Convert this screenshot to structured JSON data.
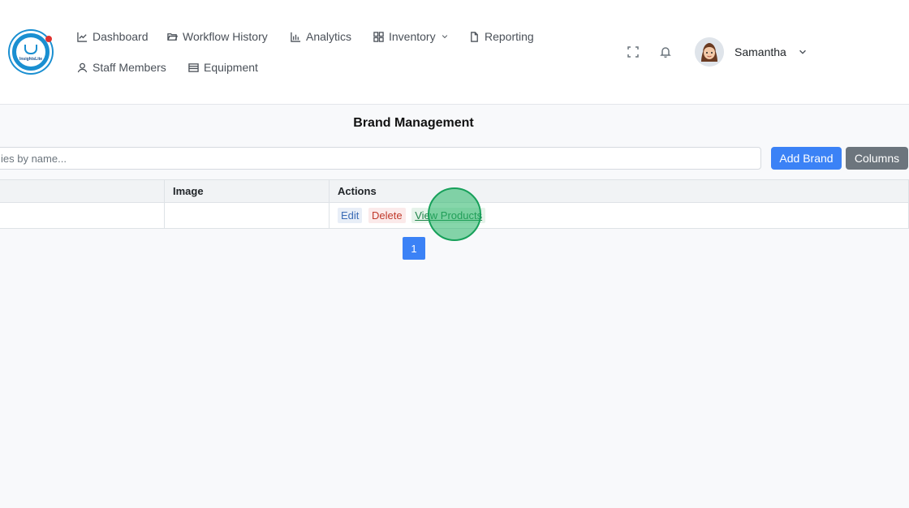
{
  "app": {
    "logo_text": "InsightsLite"
  },
  "nav": {
    "dashboard": "Dashboard",
    "workflow_history": "Workflow History",
    "analytics": "Analytics",
    "inventory": "Inventory",
    "reporting": "Reporting",
    "staff_members": "Staff Members",
    "equipment": "Equipment"
  },
  "user": {
    "name": "Samantha"
  },
  "main": {
    "title": "Brand Management",
    "search_placeholder": "ies by name...",
    "add_button": "Add Brand",
    "columns_button": "Columns"
  },
  "table": {
    "headers": [
      "",
      "Image",
      "Actions"
    ],
    "rows": [
      {
        "col1": "",
        "image": "",
        "actions": {
          "edit": "Edit",
          "delete": "Delete",
          "view": "View Products"
        }
      }
    ]
  },
  "pagination": {
    "current": "1"
  }
}
